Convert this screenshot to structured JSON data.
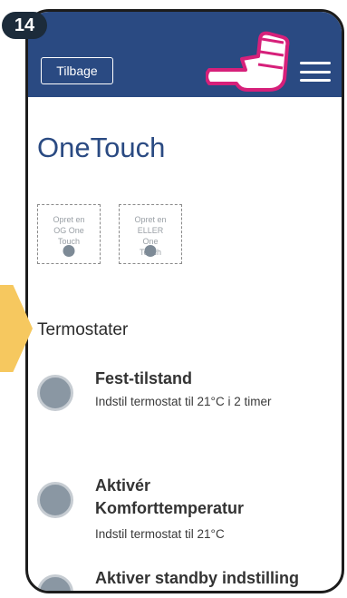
{
  "step": {
    "number": "14"
  },
  "header": {
    "back_label": "Tilbage"
  },
  "page_title": "OneTouch",
  "action_cards": [
    {
      "lines": [
        "Opret en",
        "OG One",
        "Touch"
      ]
    },
    {
      "lines": [
        "Opret en",
        "ELLER",
        "One",
        "Touch"
      ]
    }
  ],
  "section_title": "Termostater",
  "items": [
    {
      "title": "Fest-tilstand",
      "desc": "Indstil termostat til 21°C i 2 timer"
    },
    {
      "title_line1": "Aktivér",
      "title_line2": "Komforttemperatur",
      "desc": "Indstil termostat til 21°C"
    },
    {
      "title": "Aktiver standby indstilling"
    }
  ],
  "colors": {
    "header": "#2a4a82",
    "accent_hand": "#d6207a",
    "arrow": "#f6c85f"
  },
  "icons": [
    "hand-pointer-icon",
    "hamburger-menu-icon",
    "plus-circle-icon",
    "toggle-circle-icon"
  ]
}
